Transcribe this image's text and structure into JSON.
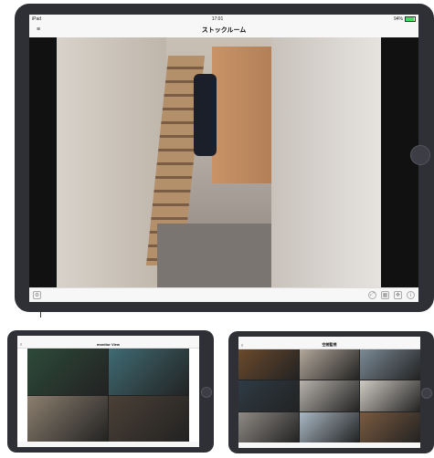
{
  "main": {
    "status": {
      "device": "iPad",
      "time": "17:01",
      "battery": "94%"
    },
    "title": "ストックルーム",
    "menu_glyph": "≡",
    "toolbar": {
      "left_icon": "camera-settings-icon",
      "right_icons": [
        "fullscreen-icon",
        "grid-layout-icon",
        "ptz-control-icon",
        "info-icon"
      ]
    }
  },
  "small1": {
    "title": "monitor View",
    "tile_colors": [
      "#2d4a3a",
      "#3f6b73",
      "#8c7f6f",
      "#4b4036"
    ]
  },
  "small2": {
    "title": "空間監視",
    "tile_colors": [
      "#6b4a2c",
      "#b2a79a",
      "#7b8a96",
      "#2e3b45",
      "#b7b2ac",
      "#cfcac3",
      "#8f8a85",
      "#a9b8c4",
      "#7a5a3f"
    ]
  },
  "colors": {
    "bezel": "#2f3036",
    "bar": "#f7f7f7",
    "battery": "#4cd964"
  }
}
